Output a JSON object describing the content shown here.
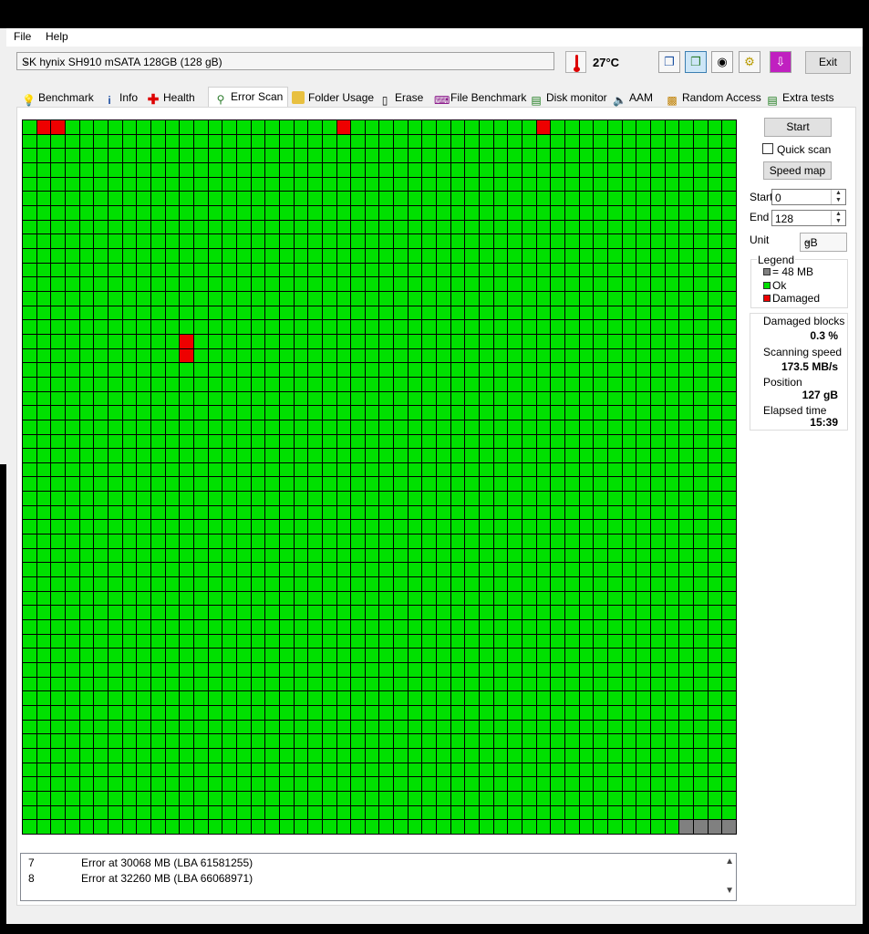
{
  "menu": {
    "file": "File",
    "help": "Help"
  },
  "drive": {
    "selected": "SK hynix SH910 mSATA 128GB (128 gB)"
  },
  "temperature": "27°C",
  "toolbar": {
    "exit_label": "Exit"
  },
  "tabs": [
    {
      "label": "Benchmark",
      "icon": "bulb-icon"
    },
    {
      "label": "Info",
      "icon": "info-icon"
    },
    {
      "label": "Health",
      "icon": "health-cross-icon"
    },
    {
      "label": "Error Scan",
      "icon": "magnifier-icon"
    },
    {
      "label": "Folder Usage",
      "icon": "folder-icon"
    },
    {
      "label": "Erase",
      "icon": "trash-icon"
    },
    {
      "label": "File Benchmark",
      "icon": "file-benchmark-icon"
    },
    {
      "label": "Disk monitor",
      "icon": "disk-monitor-icon"
    },
    {
      "label": "AAM",
      "icon": "speaker-icon"
    },
    {
      "label": "Random Access",
      "icon": "random-access-icon"
    },
    {
      "label": "Extra tests",
      "icon": "extra-tests-icon"
    }
  ],
  "active_tab": "Error Scan",
  "controls": {
    "start_button": "Start",
    "quick_scan_label": "Quick scan",
    "quick_scan_checked": false,
    "speed_map_button": "Speed map",
    "start_label": "Start",
    "start_value": "0",
    "end_label": "End",
    "end_value": "128",
    "unit_label": "Unit",
    "unit_value": "gB"
  },
  "legend": {
    "title": "Legend",
    "items": [
      {
        "label": "= 48 MB",
        "color": "#808080"
      },
      {
        "label": "Ok",
        "color": "#00e000"
      },
      {
        "label": "Damaged",
        "color": "#ee0000"
      }
    ]
  },
  "stats": {
    "damaged_blocks_label": "Damaged blocks",
    "damaged_blocks_value": "0.3 %",
    "scanning_speed_label": "Scanning speed",
    "scanning_speed_value": "173.5 MB/s",
    "position_label": "Position",
    "position_value": "127 gB",
    "elapsed_label": "Elapsed time",
    "elapsed_value": "15:39"
  },
  "scan_map": {
    "columns": 50,
    "rows": 50,
    "damaged_blocks": [
      1,
      2,
      22,
      36,
      761,
      811
    ],
    "unscanned_blocks": [
      2496,
      2497,
      2498,
      2499
    ]
  },
  "log": [
    {
      "n": "7",
      "text": "Error at 30068 MB (LBA 61581255)"
    },
    {
      "n": "8",
      "text": "Error at 32260 MB (LBA 66068971)"
    }
  ]
}
